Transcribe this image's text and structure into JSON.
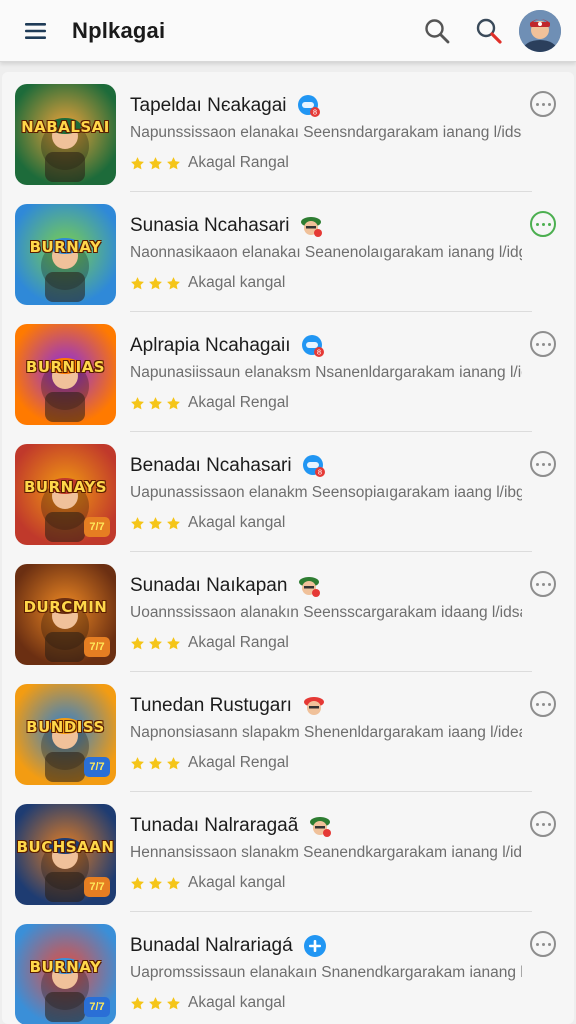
{
  "app": {
    "title": "Nplkagai"
  },
  "header_icons": [
    "hamburger-menu-icon",
    "search-icon",
    "search-icon",
    "avatar"
  ],
  "colors": {
    "star": "#f5c518",
    "accent_green": "#4caf50",
    "badge_blue": "#2196f3",
    "badge_red": "#e53935"
  },
  "items": [
    {
      "title": "Tapeldaı Nєakagai",
      "description": "Napunssissaon elanakaı Seensndargarakam ianang l/idsan",
      "rating_label": "Akagal Rangal",
      "stars": 3,
      "thumb_text": "NABALSAI",
      "thumb_badge": "",
      "badge_icon": "gamepad-badge-icon",
      "more_style": "grey",
      "theme": [
        "#1d6b3a",
        "#f2a33a"
      ]
    },
    {
      "title": "Sunasia Ncahasari",
      "description": "Naonnasikaaon elanakaı Seanenolaıgarakam ianang l/idgan",
      "rating_label": "Akagal kangal",
      "stars": 3,
      "thumb_text": "BURNAY",
      "thumb_badge": "",
      "badge_icon": "soldier-badge-icon",
      "more_style": "green",
      "theme": [
        "#2f89d8",
        "#7bd04a"
      ]
    },
    {
      "title": "Aplrapia Ncahagaiı",
      "description": "Napunasiissaun elanaksm Nsanenldargarakam ianang l/idsan",
      "rating_label": "Akagal Rengal",
      "stars": 3,
      "thumb_text": "BURNIAS",
      "thumb_badge": "",
      "badge_icon": "gamepad-badge-icon",
      "more_style": "grey",
      "theme": [
        "#ff7a00",
        "#8a2be2"
      ]
    },
    {
      "title": "Benadaı Ncahasari",
      "description": "Uapunassissaon elanakm Seensopiaıgarakam iaang l/ibgan",
      "rating_label": "Akagal kangal",
      "stars": 3,
      "thumb_text": "BURNAYS",
      "thumb_badge": "7/7",
      "badge_icon": "gamepad-badge-icon",
      "more_style": "grey",
      "theme": [
        "#c0392b",
        "#f39c12"
      ]
    },
    {
      "title": "Sunadaı Naıkapan",
      "description": "Uoannssissaon alanakın Seensscargarakam idaang l/idsan",
      "rating_label": "Akagal Rangal",
      "stars": 3,
      "thumb_text": "DURCMIN",
      "thumb_badge": "7/7",
      "badge_icon": "soldier-badge-icon",
      "more_style": "grey",
      "theme": [
        "#6b2f12",
        "#f08a24"
      ]
    },
    {
      "title": "Tunedan Rustugarı",
      "description": "Napnonsiasann slapakm Shenenldargarakam iaang l/idean",
      "rating_label": "Akagal Rengal",
      "stars": 3,
      "thumb_text": "BUNDISS",
      "thumb_badge": "7/7",
      "badge_icon": "soldier-red-badge-icon",
      "more_style": "grey",
      "theme": [
        "#f39c12",
        "#2a7fd4"
      ]
    },
    {
      "title": "Tunadaı Nalraragaã",
      "description": "Hennansissaon slanakm Seanendkargarakam ianang l/idsan",
      "rating_label": "Akagal kangal",
      "stars": 3,
      "thumb_text": "BUCHSAAN",
      "thumb_badge": "7/7",
      "badge_icon": "soldier-badge-icon",
      "more_style": "grey",
      "theme": [
        "#1e3c72",
        "#e67e22"
      ]
    },
    {
      "title": "Bunadal Nalrariagá",
      "description": "Uapromssissaun elanakaın Snanendkargarakam ianang l/idsan",
      "rating_label": "Akagal kangal",
      "stars": 3,
      "thumb_text": "BURNAY",
      "thumb_badge": "7/7",
      "badge_icon": "plus-badge-icon",
      "more_style": "grey",
      "theme": [
        "#3a8fd8",
        "#e74c3c"
      ]
    }
  ]
}
